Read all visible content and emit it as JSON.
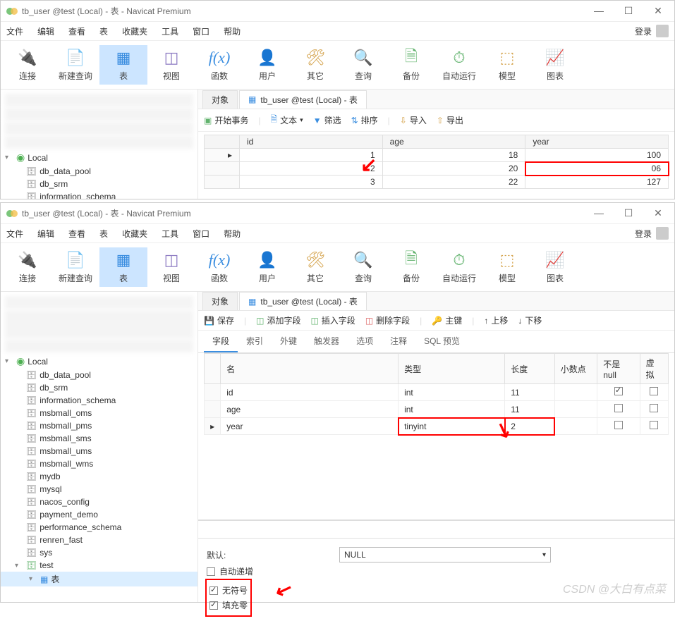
{
  "window1": {
    "title": "tb_user @test (Local) - 表 - Navicat Premium",
    "menus": [
      "文件",
      "编辑",
      "查看",
      "表",
      "收藏夹",
      "工具",
      "窗口",
      "帮助"
    ],
    "login": "登录",
    "toolbar": [
      {
        "label": "连接",
        "icon": "🔌",
        "color": "#3b8ee0"
      },
      {
        "label": "新建查询",
        "icon": "📄",
        "color": "#3b8ee0"
      },
      {
        "label": "表",
        "icon": "▦",
        "color": "#3b8ee0",
        "active": true
      },
      {
        "label": "视图",
        "icon": "◫",
        "color": "#8e7cc3"
      },
      {
        "label": "函数",
        "icon": "f(x)",
        "color": "#3b8ee0",
        "fx": true
      },
      {
        "label": "用户",
        "icon": "👤",
        "color": "#d4a24a"
      },
      {
        "label": "其它",
        "icon": "🛠",
        "color": "#d4a24a"
      },
      {
        "label": "查询",
        "icon": "🔍",
        "color": "#d4a24a"
      },
      {
        "label": "备份",
        "icon": "🗎",
        "color": "#62b36e"
      },
      {
        "label": "自动运行",
        "icon": "⏱",
        "color": "#62b36e"
      },
      {
        "label": "模型",
        "icon": "⬚",
        "color": "#d4a24a"
      },
      {
        "label": "图表",
        "icon": "📈",
        "color": "#d4a24a"
      }
    ],
    "tree": {
      "connection": "Local",
      "dbs": [
        "db_data_pool",
        "db_srm",
        "information_schema"
      ]
    },
    "tabs": {
      "object": "对象",
      "current": "tb_user @test (Local) - 表"
    },
    "actions": {
      "begin": "开始事务",
      "text": "文本",
      "filter": "筛选",
      "sort": "排序",
      "import": "导入",
      "export": "导出"
    },
    "grid": {
      "headers": [
        "id",
        "age",
        "year"
      ],
      "rows": [
        {
          "ptr": "▸",
          "id": "1",
          "age": "18",
          "year": "100"
        },
        {
          "ptr": "",
          "id": "2",
          "age": "20",
          "year": "06",
          "highlight": true
        },
        {
          "ptr": "",
          "id": "3",
          "age": "22",
          "year": "127"
        }
      ]
    }
  },
  "window2": {
    "title": "tb_user @test (Local) - 表 - Navicat Premium",
    "menus": [
      "文件",
      "编辑",
      "查看",
      "表",
      "收藏夹",
      "工具",
      "窗口",
      "帮助"
    ],
    "login": "登录",
    "tree": {
      "connection": "Local",
      "dbs": [
        "db_data_pool",
        "db_srm",
        "information_schema",
        "msbmall_oms",
        "msbmall_pms",
        "msbmall_sms",
        "msbmall_ums",
        "msbmall_wms",
        "mydb",
        "mysql",
        "nacos_config",
        "payment_demo",
        "performance_schema",
        "renren_fast",
        "sys"
      ],
      "openDb": "test",
      "openItem": "表"
    },
    "tabs": {
      "object": "对象",
      "current": "tb_user @test (Local) - 表"
    },
    "actions": {
      "save": "保存",
      "addField": "添加字段",
      "insertField": "插入字段",
      "deleteField": "删除字段",
      "primaryKey": "主键",
      "moveUp": "上移",
      "moveDown": "下移"
    },
    "subtabs": [
      "字段",
      "索引",
      "外键",
      "触发器",
      "选项",
      "注释",
      "SQL 预览"
    ],
    "design": {
      "headers": [
        "名",
        "类型",
        "长度",
        "小数点",
        "不是 null",
        "虚拟"
      ],
      "rows": [
        {
          "ptr": "",
          "name": "id",
          "type": "int",
          "len": "11",
          "dec": "",
          "notnull": true,
          "virt": false
        },
        {
          "ptr": "",
          "name": "age",
          "type": "int",
          "len": "11",
          "dec": "",
          "notnull": false,
          "virt": false
        },
        {
          "ptr": "▸",
          "name": "year",
          "type": "tinyint",
          "len": "2",
          "dec": "",
          "notnull": false,
          "virt": false,
          "highlight": true
        }
      ]
    },
    "bottom": {
      "defaultLabel": "默认:",
      "defaultValue": "NULL",
      "autoInc": "自动递增",
      "unsigned": "无符号",
      "zerofill": "填充零"
    }
  },
  "watermark": "CSDN @大白有点菜"
}
